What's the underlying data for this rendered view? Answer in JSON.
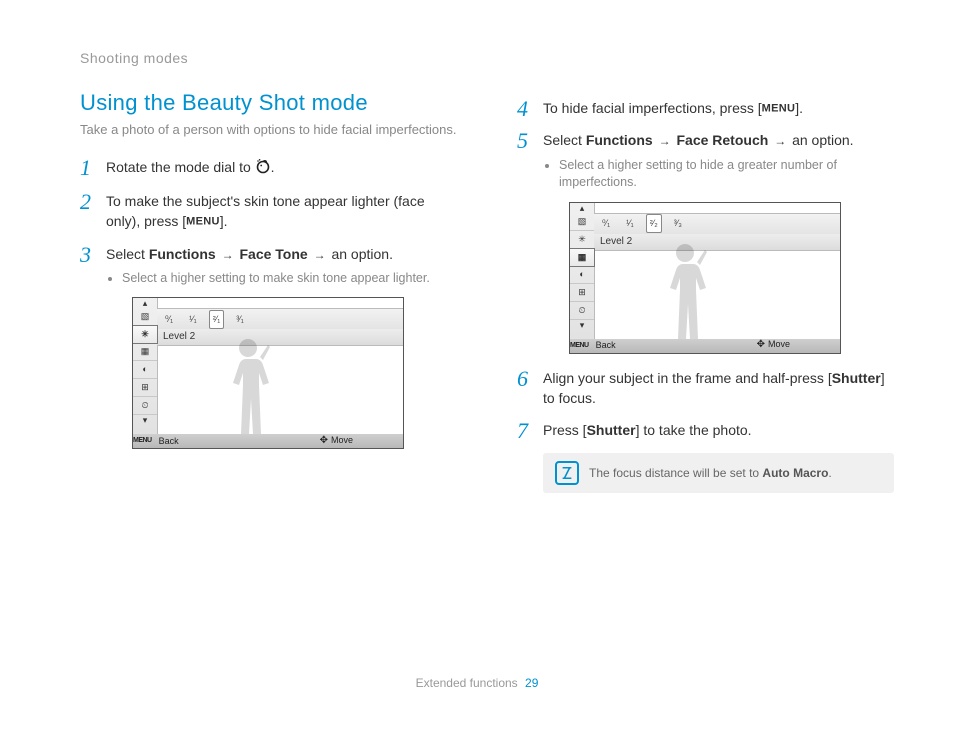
{
  "section_header": "Shooting modes",
  "heading": "Using the Beauty Shot mode",
  "subtitle": "Take a photo of a person with options to hide facial imperfections.",
  "steps": {
    "s1_pre": "Rotate the mode dial to ",
    "s1_post": ".",
    "s2_pre": "To make the subject's skin tone appear lighter (face only), press [",
    "s2_menu": "MENU",
    "s2_post": "].",
    "s3_pre": "Select ",
    "s3_b1": "Functions",
    "s3_b2": "Face Tone",
    "s3_post": " an option.",
    "s3_sub": "Select a higher setting to make skin tone appear lighter.",
    "s4_pre": "To hide facial imperfections, press [",
    "s4_menu": "MENU",
    "s4_post": "].",
    "s5_pre": "Select ",
    "s5_b1": "Functions",
    "s5_b2": "Face Retouch",
    "s5_post": " an option.",
    "s5_sub": "Select a higher setting to hide a greater number of imperfections.",
    "s6_pre": "Align your subject in the frame and half-press [",
    "s6_b": "Shutter",
    "s6_post": "] to focus.",
    "s7_pre": "Press [",
    "s7_b": "Shutter",
    "s7_post": "] to take the photo."
  },
  "camui": {
    "level_label": "Level 2",
    "back": "Back",
    "move": "Move",
    "menu_label": "MENU",
    "top_options_a": [
      "⁰⁄₁",
      "¹⁄₁",
      "²⁄₁",
      "³⁄₁"
    ],
    "top_options_b": [
      "⁰⁄₁",
      "¹⁄₁",
      "²⁄₂",
      "³⁄₃"
    ],
    "side_icons": [
      "▧",
      "✳",
      "▦",
      "◐",
      "⊞",
      "⏲"
    ]
  },
  "note": {
    "text_pre": "The focus distance will be set to ",
    "text_bold": "Auto Macro",
    "text_post": "."
  },
  "footer": {
    "label": "Extended functions",
    "page": "29"
  }
}
